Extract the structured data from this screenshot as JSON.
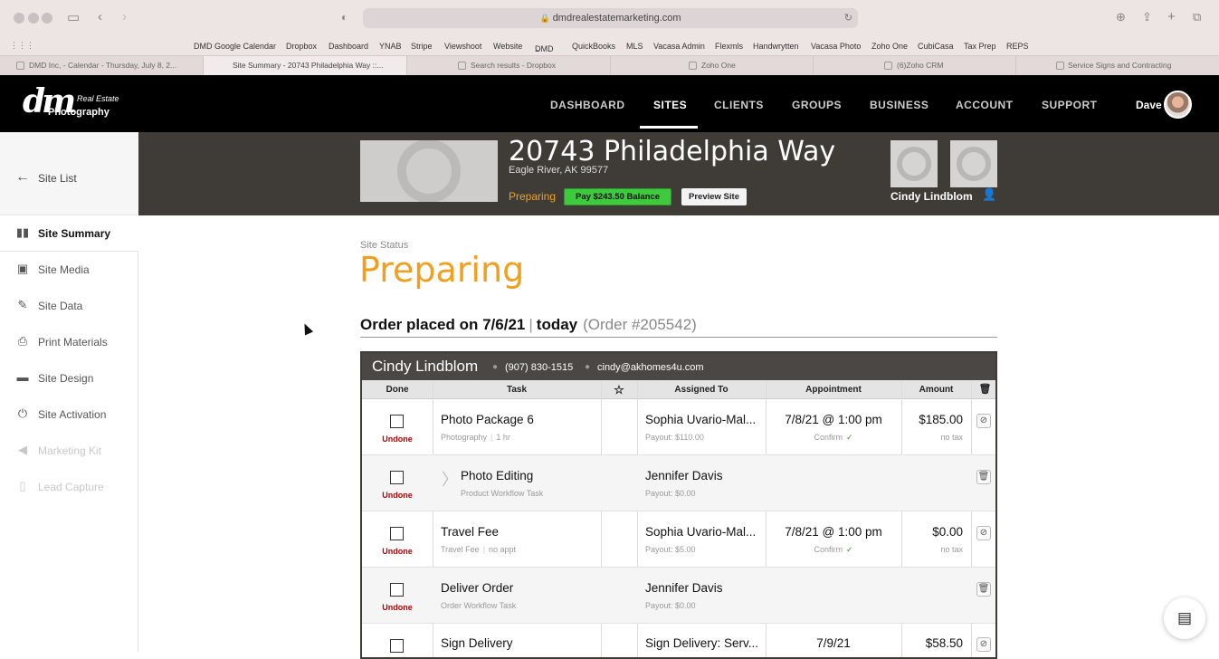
{
  "browser": {
    "url": "dmdrealestatemarketing.com",
    "bookmarks": [
      "DMD Google Calendar",
      "Dropbox",
      "Dashboard",
      "YNAB",
      "Stripe",
      "Viewshoot",
      "Website",
      "DMD",
      "QuickBooks",
      "MLS",
      "Vacasa Admin",
      "Flexmls",
      "Handwrytten",
      "Vacasa Photo",
      "Zoho One",
      "CubiCasa",
      "Tax Prep",
      "REPS"
    ],
    "tabs": [
      "DMD Inc, - Calendar - Thursday, July 8, 2...",
      "Site Summary - 20743 Philadelphia Way ::...",
      "Search results - Dropbox",
      "Zoho One",
      "(6)Zoho CRM",
      "Service Signs and Contracting"
    ]
  },
  "brand": {
    "logo_mark": "dm",
    "logo_line1": "Real Estate",
    "logo_line2": "Photography"
  },
  "nav": {
    "items": [
      "DASHBOARD",
      "SITES",
      "CLIENTS",
      "GROUPS",
      "BUSINESS",
      "ACCOUNT",
      "SUPPORT"
    ],
    "user": "Dave"
  },
  "sidebar": {
    "back_label": "Site List",
    "items": [
      {
        "label": "Site Summary",
        "icon": "bar-chart-icon"
      },
      {
        "label": "Site Media",
        "icon": "images-icon"
      },
      {
        "label": "Site Data",
        "icon": "edit-icon"
      },
      {
        "label": "Print Materials",
        "icon": "printer-icon"
      },
      {
        "label": "Site Design",
        "icon": "paint-brush-icon"
      },
      {
        "label": "Site Activation",
        "icon": "power-icon"
      },
      {
        "label": "Marketing Kit",
        "icon": "megaphone-icon"
      },
      {
        "label": "Lead Capture",
        "icon": "phone-icon"
      }
    ]
  },
  "site": {
    "address": "20743 Philadelphia Way",
    "city": "Eagle River, AK  99577",
    "status": "Preparing",
    "pay_button": "Pay $243.50 Balance",
    "preview_button": "Preview Site",
    "agent": "Cindy Lindblom"
  },
  "summary": {
    "status_label": "Site Status",
    "status": "Preparing",
    "order_text": "Order placed on 7/6/21",
    "order_today": "today",
    "order_number": "(Order #205542)"
  },
  "order": {
    "client_name": "Cindy Lindblom",
    "phone": "(907) 830-1515",
    "email": "cindy@akhomes4u.com",
    "columns": [
      "Done",
      "Task",
      "Assigned To",
      "Appointment",
      "Amount"
    ],
    "rows": [
      {
        "status": "Undone",
        "task": "Photo Package 6",
        "sub1": "Photography",
        "sub2": "1 hr",
        "assigned": "Sophia Uvario-Mal...",
        "payout": "Payout: $110.00",
        "appt": "7/8/21 @ 1:00 pm",
        "confirm": "Confirm",
        "amount": "$185.00",
        "tax": "no tax"
      },
      {
        "status": "Undone",
        "task": "Photo Editing",
        "sub1": "Product Workflow Task",
        "sub2": "",
        "assigned": "Jennifer Davis",
        "payout": "Payout: $0.00",
        "appt": "",
        "confirm": "",
        "amount": "",
        "tax": ""
      },
      {
        "status": "Undone",
        "task": "Travel Fee",
        "sub1": "Travel Fee",
        "sub2": "no appt",
        "assigned": "Sophia Uvario-Mal...",
        "payout": "Payout: $5.00",
        "appt": "7/8/21 @ 1:00 pm",
        "confirm": "Confirm",
        "amount": "$0.00",
        "tax": "no tax"
      },
      {
        "status": "Undone",
        "task": "Deliver Order",
        "sub1": "Order Workflow Task",
        "sub2": "",
        "assigned": "Jennifer Davis",
        "payout": "Payout: $0.00",
        "appt": "",
        "confirm": "",
        "amount": "",
        "tax": ""
      },
      {
        "status": "",
        "task": "Sign Delivery",
        "sub1": "",
        "sub2": "",
        "assigned": "Sign Delivery: Serv...",
        "payout": "",
        "appt": "7/9/21",
        "confirm": "",
        "amount": "$58.50",
        "tax": ""
      }
    ]
  }
}
